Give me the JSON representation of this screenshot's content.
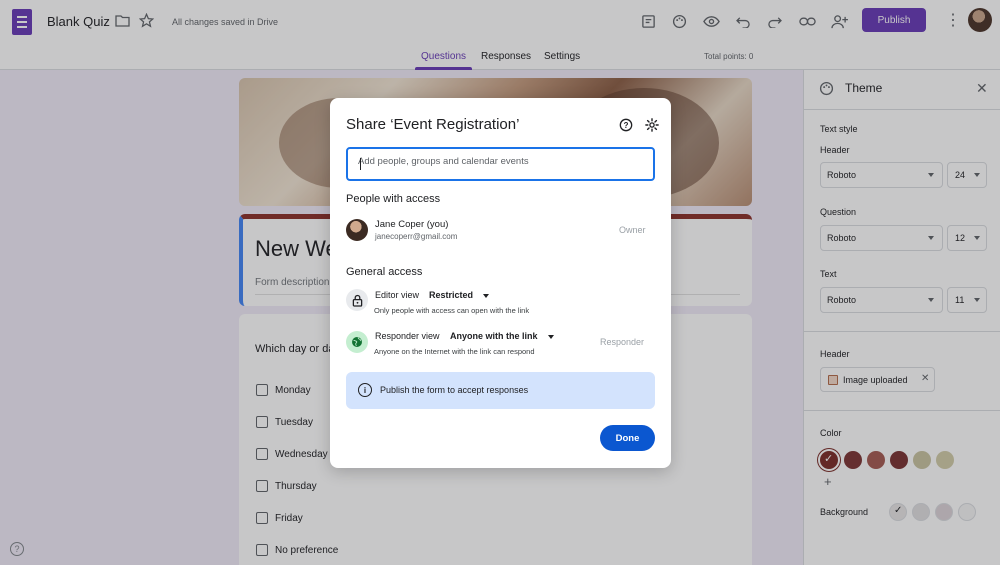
{
  "app": {
    "doc_title": "Blank Quiz",
    "saved_status": "All changes saved in Drive",
    "publish_label": "Publish"
  },
  "tabs": [
    {
      "label": "Questions",
      "active": true
    },
    {
      "label": "Responses",
      "active": false
    },
    {
      "label": "Settings",
      "active": false
    }
  ],
  "total_points": "Total points: 0",
  "form": {
    "title": "New We",
    "description": "Form description",
    "question": "Which day or da",
    "options": [
      "Monday",
      "Tuesday",
      "Wednesday",
      "Thursday",
      "Friday",
      "No preference"
    ]
  },
  "theme": {
    "panel_title": "Theme",
    "text_style_label": "Text style",
    "header_label": "Header",
    "header_font": "Roboto",
    "header_size": "24",
    "question_label": "Question",
    "question_font": "Roboto",
    "question_size": "12",
    "text_label": "Text",
    "text_font": "Roboto",
    "text_size": "11",
    "header_section_label": "Header",
    "image_chip": "Image uploaded",
    "color_label": "Color",
    "colors": [
      "#7b2d28",
      "#7c3434",
      "#a45a52",
      "#7a3232",
      "#c9c3a1",
      "#d2cca9"
    ],
    "background_label": "Background",
    "backgrounds": [
      "#e8e6e6",
      "#e1dfe0",
      "#dcd3d8",
      "#f5f5f5"
    ]
  },
  "dialog": {
    "title": "Share ‘Event Registration’",
    "input_placeholder": "Add people, groups and calendar events",
    "people_heading": "People with access",
    "person_name": "Jane Coper (you)",
    "person_email": "janecoperr@gmail.com",
    "person_role": "Owner",
    "general_heading": "General access",
    "editor_label": "Editor view",
    "editor_value": "Restricted",
    "editor_desc": "Only people with access can open with the link",
    "responder_label": "Responder view",
    "responder_value": "Anyone with the link",
    "responder_desc": "Anyone on the Internet with the link can respond",
    "responder_role": "Responder",
    "banner_text": "Publish the form to accept responses",
    "done_label": "Done"
  }
}
